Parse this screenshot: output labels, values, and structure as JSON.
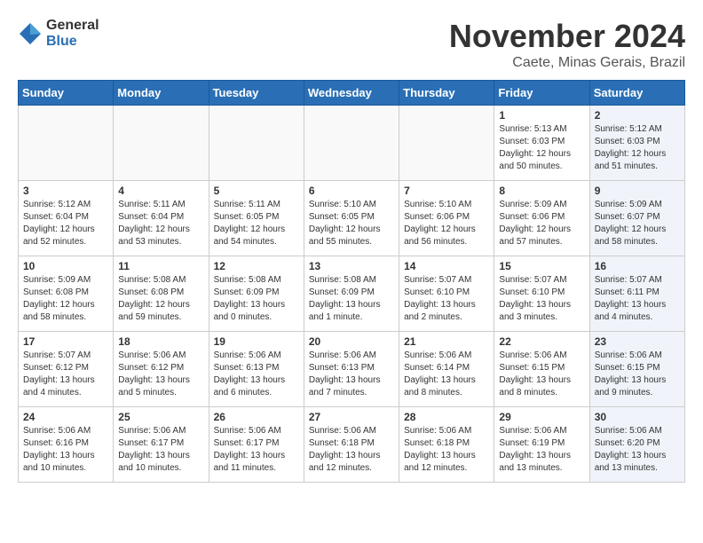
{
  "logo": {
    "general": "General",
    "blue": "Blue"
  },
  "title": "November 2024",
  "location": "Caete, Minas Gerais, Brazil",
  "days_of_week": [
    "Sunday",
    "Monday",
    "Tuesday",
    "Wednesday",
    "Thursday",
    "Friday",
    "Saturday"
  ],
  "weeks": [
    [
      {
        "day": "",
        "info": "",
        "empty": true
      },
      {
        "day": "",
        "info": "",
        "empty": true
      },
      {
        "day": "",
        "info": "",
        "empty": true
      },
      {
        "day": "",
        "info": "",
        "empty": true
      },
      {
        "day": "",
        "info": "",
        "empty": true
      },
      {
        "day": "1",
        "info": "Sunrise: 5:13 AM\nSunset: 6:03 PM\nDaylight: 12 hours\nand 50 minutes.",
        "empty": false,
        "shaded": false
      },
      {
        "day": "2",
        "info": "Sunrise: 5:12 AM\nSunset: 6:03 PM\nDaylight: 12 hours\nand 51 minutes.",
        "empty": false,
        "shaded": true
      }
    ],
    [
      {
        "day": "3",
        "info": "Sunrise: 5:12 AM\nSunset: 6:04 PM\nDaylight: 12 hours\nand 52 minutes.",
        "empty": false,
        "shaded": false
      },
      {
        "day": "4",
        "info": "Sunrise: 5:11 AM\nSunset: 6:04 PM\nDaylight: 12 hours\nand 53 minutes.",
        "empty": false,
        "shaded": false
      },
      {
        "day": "5",
        "info": "Sunrise: 5:11 AM\nSunset: 6:05 PM\nDaylight: 12 hours\nand 54 minutes.",
        "empty": false,
        "shaded": false
      },
      {
        "day": "6",
        "info": "Sunrise: 5:10 AM\nSunset: 6:05 PM\nDaylight: 12 hours\nand 55 minutes.",
        "empty": false,
        "shaded": false
      },
      {
        "day": "7",
        "info": "Sunrise: 5:10 AM\nSunset: 6:06 PM\nDaylight: 12 hours\nand 56 minutes.",
        "empty": false,
        "shaded": false
      },
      {
        "day": "8",
        "info": "Sunrise: 5:09 AM\nSunset: 6:06 PM\nDaylight: 12 hours\nand 57 minutes.",
        "empty": false,
        "shaded": false
      },
      {
        "day": "9",
        "info": "Sunrise: 5:09 AM\nSunset: 6:07 PM\nDaylight: 12 hours\nand 58 minutes.",
        "empty": false,
        "shaded": true
      }
    ],
    [
      {
        "day": "10",
        "info": "Sunrise: 5:09 AM\nSunset: 6:08 PM\nDaylight: 12 hours\nand 58 minutes.",
        "empty": false,
        "shaded": false
      },
      {
        "day": "11",
        "info": "Sunrise: 5:08 AM\nSunset: 6:08 PM\nDaylight: 12 hours\nand 59 minutes.",
        "empty": false,
        "shaded": false
      },
      {
        "day": "12",
        "info": "Sunrise: 5:08 AM\nSunset: 6:09 PM\nDaylight: 13 hours\nand 0 minutes.",
        "empty": false,
        "shaded": false
      },
      {
        "day": "13",
        "info": "Sunrise: 5:08 AM\nSunset: 6:09 PM\nDaylight: 13 hours\nand 1 minute.",
        "empty": false,
        "shaded": false
      },
      {
        "day": "14",
        "info": "Sunrise: 5:07 AM\nSunset: 6:10 PM\nDaylight: 13 hours\nand 2 minutes.",
        "empty": false,
        "shaded": false
      },
      {
        "day": "15",
        "info": "Sunrise: 5:07 AM\nSunset: 6:10 PM\nDaylight: 13 hours\nand 3 minutes.",
        "empty": false,
        "shaded": false
      },
      {
        "day": "16",
        "info": "Sunrise: 5:07 AM\nSunset: 6:11 PM\nDaylight: 13 hours\nand 4 minutes.",
        "empty": false,
        "shaded": true
      }
    ],
    [
      {
        "day": "17",
        "info": "Sunrise: 5:07 AM\nSunset: 6:12 PM\nDaylight: 13 hours\nand 4 minutes.",
        "empty": false,
        "shaded": false
      },
      {
        "day": "18",
        "info": "Sunrise: 5:06 AM\nSunset: 6:12 PM\nDaylight: 13 hours\nand 5 minutes.",
        "empty": false,
        "shaded": false
      },
      {
        "day": "19",
        "info": "Sunrise: 5:06 AM\nSunset: 6:13 PM\nDaylight: 13 hours\nand 6 minutes.",
        "empty": false,
        "shaded": false
      },
      {
        "day": "20",
        "info": "Sunrise: 5:06 AM\nSunset: 6:13 PM\nDaylight: 13 hours\nand 7 minutes.",
        "empty": false,
        "shaded": false
      },
      {
        "day": "21",
        "info": "Sunrise: 5:06 AM\nSunset: 6:14 PM\nDaylight: 13 hours\nand 8 minutes.",
        "empty": false,
        "shaded": false
      },
      {
        "day": "22",
        "info": "Sunrise: 5:06 AM\nSunset: 6:15 PM\nDaylight: 13 hours\nand 8 minutes.",
        "empty": false,
        "shaded": false
      },
      {
        "day": "23",
        "info": "Sunrise: 5:06 AM\nSunset: 6:15 PM\nDaylight: 13 hours\nand 9 minutes.",
        "empty": false,
        "shaded": true
      }
    ],
    [
      {
        "day": "24",
        "info": "Sunrise: 5:06 AM\nSunset: 6:16 PM\nDaylight: 13 hours\nand 10 minutes.",
        "empty": false,
        "shaded": false
      },
      {
        "day": "25",
        "info": "Sunrise: 5:06 AM\nSunset: 6:17 PM\nDaylight: 13 hours\nand 10 minutes.",
        "empty": false,
        "shaded": false
      },
      {
        "day": "26",
        "info": "Sunrise: 5:06 AM\nSunset: 6:17 PM\nDaylight: 13 hours\nand 11 minutes.",
        "empty": false,
        "shaded": false
      },
      {
        "day": "27",
        "info": "Sunrise: 5:06 AM\nSunset: 6:18 PM\nDaylight: 13 hours\nand 12 minutes.",
        "empty": false,
        "shaded": false
      },
      {
        "day": "28",
        "info": "Sunrise: 5:06 AM\nSunset: 6:18 PM\nDaylight: 13 hours\nand 12 minutes.",
        "empty": false,
        "shaded": false
      },
      {
        "day": "29",
        "info": "Sunrise: 5:06 AM\nSunset: 6:19 PM\nDaylight: 13 hours\nand 13 minutes.",
        "empty": false,
        "shaded": false
      },
      {
        "day": "30",
        "info": "Sunrise: 5:06 AM\nSunset: 6:20 PM\nDaylight: 13 hours\nand 13 minutes.",
        "empty": false,
        "shaded": true
      }
    ]
  ]
}
